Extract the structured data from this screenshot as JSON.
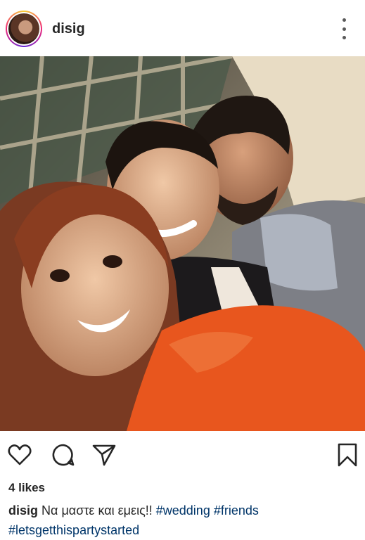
{
  "post": {
    "username": "disig",
    "likes": "4 likes",
    "caption_text": "Να μαστε και εμεις!!",
    "hashtags": [
      "#wedding",
      "#friends",
      "#letsgetthispartystarted"
    ]
  },
  "icons": {
    "like": "heart-outline-icon",
    "comment": "comment-bubble-icon",
    "share": "paper-plane-icon",
    "save": "bookmark-icon",
    "more": "vertical-dots-icon"
  },
  "colors": {
    "text": "#262626",
    "hashtag": "#003569",
    "dress": "#e8561e"
  }
}
